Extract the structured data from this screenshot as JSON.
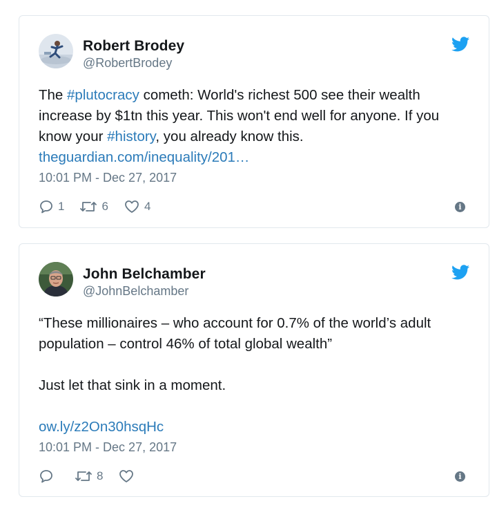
{
  "tweets": [
    {
      "name": "Robert Brodey",
      "handle": "@RobertBrodey",
      "text_parts": {
        "p1": "The ",
        "tag1": "#plutocracy",
        "p2": " cometh: World's richest 500 see their wealth increase by $1tn this year. This won't end well for anyone. If you know your ",
        "tag2": "#history",
        "p3": ", you already know this.",
        "link": "theguardian.com/inequality/201…"
      },
      "timestamp": "10:01 PM - Dec 27, 2017",
      "replies": "1",
      "retweets": "6",
      "likes": "4",
      "info": "i"
    },
    {
      "name": "John Belchamber",
      "handle": "@JohnBelchamber",
      "text_parts": {
        "quote": "“These millionaires – who account for 0.7% of the world’s adult population – control 46% of total global wealth”",
        "line2": "Just let that sink in a moment.",
        "link": "ow.ly/z2On30hsqHc"
      },
      "timestamp": "10:01 PM - Dec 27, 2017",
      "retweets": "8",
      "info": "i"
    }
  ],
  "icons": {
    "bird": "twitter-bird-icon",
    "reply": "reply-icon",
    "retweet": "retweet-icon",
    "like": "heart-icon",
    "info": "info-icon"
  },
  "colors": {
    "accent": "#1da1f2",
    "link": "#2b7bb9",
    "muted": "#657786",
    "border": "#e1e8ed"
  }
}
